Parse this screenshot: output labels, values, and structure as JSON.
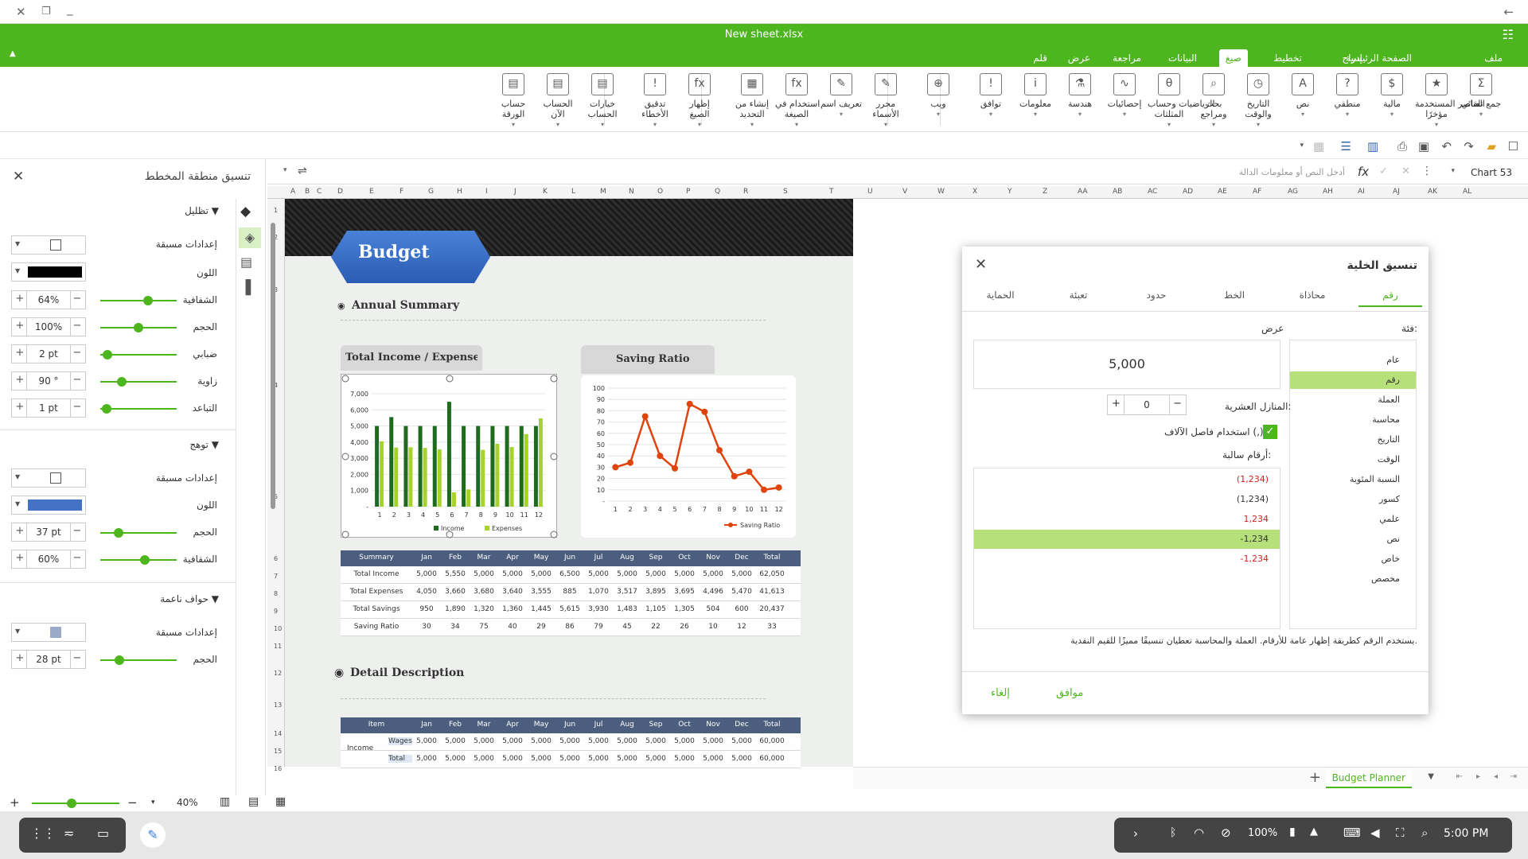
{
  "window": {
    "title": "New sheet.xlsx"
  },
  "ribbon_tabs": [
    {
      "label": "ملف",
      "x": 1876,
      "active": false
    },
    {
      "label": "الصفحة الرئيسية",
      "x": 1762,
      "active": false
    },
    {
      "label": "إدراج",
      "x": 1700,
      "active": false
    },
    {
      "label": "تخطيط",
      "x": 1624,
      "active": false
    },
    {
      "label": "صيغ",
      "x": 1548,
      "active": true
    },
    {
      "label": "البيانات",
      "x": 1492,
      "active": false
    },
    {
      "label": "مراجعة",
      "x": 1422,
      "active": false
    },
    {
      "label": "عرض",
      "x": 1358,
      "active": false
    },
    {
      "label": "قلم",
      "x": 1304,
      "active": false
    }
  ],
  "ribbon_buttons": [
    {
      "line1": "جمع تلقائي",
      "line2": "",
      "icon": "Σ"
    },
    {
      "line1": "العناصر المستخدمة",
      "line2": "مؤخرًا",
      "icon": "★"
    },
    {
      "line1": "مالية",
      "line2": "",
      "icon": "$"
    },
    {
      "line1": "منطقي",
      "line2": "",
      "icon": "?"
    },
    {
      "line1": "نص",
      "line2": "",
      "icon": "A"
    },
    {
      "line1": "التاريخ",
      "line2": "والوقت",
      "icon": "◷"
    },
    {
      "line1": "بحث",
      "line2": "ومراجع",
      "icon": "⌕"
    },
    {
      "line1": "الرياضيات وحساب",
      "line2": "المثلثات",
      "icon": "θ"
    },
    {
      "line1": "إحصائيات",
      "line2": "",
      "icon": "∿"
    },
    {
      "line1": "هندسة",
      "line2": "",
      "icon": "⚗"
    },
    {
      "line1": "معلومات",
      "line2": "",
      "icon": "i"
    },
    {
      "line1": "توافق",
      "line2": "",
      "icon": "!"
    },
    {
      "line1": "ويب",
      "line2": "",
      "icon": "⊕"
    },
    {
      "line1": "محرر",
      "line2": "الأسماء",
      "icon": "✎"
    },
    {
      "line1": "تعريف اسم",
      "line2": "",
      "icon": "✎"
    },
    {
      "line1": "استخدام في",
      "line2": "الصيغة",
      "icon": "fx"
    },
    {
      "line1": "إنشاء من",
      "line2": "التحديد",
      "icon": "▦"
    },
    {
      "line1": "إظهار",
      "line2": "الصيغ",
      "icon": "fx"
    },
    {
      "line1": "تدقيق",
      "line2": "الأخطاء",
      "icon": "!"
    },
    {
      "line1": "خيارات",
      "line2": "الحساب",
      "icon": "▤"
    },
    {
      "line1": "الحساب",
      "line2": "الآن",
      "icon": "▤"
    },
    {
      "line1": "حساب",
      "line2": "الورقة",
      "icon": "▤"
    }
  ],
  "formula_bar": {
    "name_box": "Chart 53",
    "placeholder": "أدخل النص أو معلومات الدالة",
    "fx": "fx"
  },
  "columns": [
    "A",
    "B",
    "C",
    "D",
    "E",
    "F",
    "G",
    "H",
    "I",
    "J",
    "K",
    "L",
    "M",
    "N",
    "O",
    "P",
    "Q",
    "R",
    "S",
    "T",
    "U",
    "V",
    "W",
    "X",
    "Y",
    "Z",
    "AA",
    "AB",
    "AC",
    "AD",
    "AE",
    "AF",
    "AG",
    "AH",
    "AI",
    "AJ",
    "AK",
    "AL"
  ],
  "rows": [
    "1",
    "2",
    "3",
    "4",
    "5",
    "6",
    "7",
    "8",
    "9",
    "10",
    "11",
    "12",
    "13",
    "14",
    "15",
    "16"
  ],
  "left_panel": {
    "title": "تنسيق منطقة المخطط",
    "shadow_section": "تظليل",
    "glow_section": "توهج",
    "soft_section": "حواف ناعمة",
    "presets": "إعدادات مسبقة",
    "color": "اللون",
    "transparency": "الشفافية",
    "size": "الحجم",
    "blur": "ضبابي",
    "angle": "زاوية",
    "distance": "التباعد",
    "shadow_transparency": "64%",
    "shadow_transparency_level": 0.64,
    "shadow_size": "100%",
    "shadow_size_level": 0.5,
    "shadow_blur": "2 pt",
    "shadow_blur_level": 0.04,
    "shadow_angle": "90 °",
    "shadow_angle_level": 0.25,
    "shadow_distance": "1 pt",
    "shadow_distance_level": 0.02,
    "shadow_color": "#000000",
    "glow_size": "37 pt",
    "glow_size_level": 0.2,
    "glow_transparency": "60%",
    "glow_transparency_level": 0.6,
    "glow_color": "#4472c4",
    "soft_size": "28 pt",
    "soft_size_level": 0.22
  },
  "zoom": {
    "value": "40%",
    "level": 0.4
  },
  "sheet": {
    "budget_title": "Budget",
    "annual_summary": "Annual Summary",
    "detail_description": "Detail Description",
    "chart1_title": "Total Income / Expenses",
    "chart2_title": "Saving Ratio"
  },
  "summary_table": {
    "headers": [
      "Summary",
      "Jan",
      "Feb",
      "Mar",
      "Apr",
      "May",
      "Jun",
      "Jul",
      "Aug",
      "Sep",
      "Oct",
      "Nov",
      "Dec",
      "Total"
    ],
    "rows": [
      [
        "Total Income",
        "5,000",
        "5,550",
        "5,000",
        "5,000",
        "5,000",
        "6,500",
        "5,000",
        "5,000",
        "5,000",
        "5,000",
        "5,000",
        "5,000",
        "62,050"
      ],
      [
        "Total Expenses",
        "4,050",
        "3,660",
        "3,680",
        "3,640",
        "3,555",
        "885",
        "1,070",
        "3,517",
        "3,895",
        "3,695",
        "4,496",
        "5,470",
        "41,613"
      ],
      [
        "Total Savings",
        "950",
        "1,890",
        "1,320",
        "1,360",
        "1,445",
        "5,615",
        "3,930",
        "1,483",
        "1,105",
        "1,305",
        "504",
        "600",
        "20,437"
      ],
      [
        "Saving Ratio",
        "30",
        "34",
        "75",
        "40",
        "29",
        "86",
        "79",
        "45",
        "22",
        "26",
        "10",
        "12",
        "33"
      ]
    ]
  },
  "detail_table": {
    "headers": [
      "Item",
      "Jan",
      "Feb",
      "Mar",
      "Apr",
      "May",
      "Jun",
      "Jul",
      "Aug",
      "Sep",
      "Oct",
      "Nov",
      "Dec",
      "Total"
    ],
    "group": "Income",
    "rows": [
      [
        "Wages",
        "5,000",
        "5,000",
        "5,000",
        "5,000",
        "5,000",
        "5,000",
        "5,000",
        "5,000",
        "5,000",
        "5,000",
        "5,000",
        "5,000",
        "60,000"
      ],
      [
        "Total",
        "5,000",
        "5,000",
        "5,000",
        "5,000",
        "5,000",
        "5,000",
        "5,000",
        "5,000",
        "5,000",
        "5,000",
        "5,000",
        "5,000",
        "60,000"
      ]
    ]
  },
  "chart_data": [
    {
      "type": "bar",
      "title": "Total Income / Expenses",
      "categories": [
        "1",
        "2",
        "3",
        "4",
        "5",
        "6",
        "7",
        "8",
        "9",
        "10",
        "11",
        "12"
      ],
      "series": [
        {
          "name": "Income",
          "values": [
            5000,
            5550,
            5000,
            5000,
            5000,
            6500,
            5000,
            5000,
            5000,
            5000,
            5000,
            5000
          ],
          "color": "#1e6b1e"
        },
        {
          "name": "Expenses",
          "values": [
            4050,
            3660,
            3680,
            3640,
            3555,
            885,
            1070,
            3517,
            3895,
            3695,
            4496,
            5470
          ],
          "color": "#a6d22c"
        }
      ],
      "y_ticks": [
        "-",
        "1,000",
        "2,000",
        "3,000",
        "4,000",
        "5,000",
        "6,000",
        "7,000"
      ],
      "ylim": [
        0,
        7000
      ],
      "legend": "bottom"
    },
    {
      "type": "line",
      "title": "Saving Ratio",
      "categories": [
        "1",
        "2",
        "3",
        "4",
        "5",
        "6",
        "7",
        "8",
        "9",
        "10",
        "11",
        "12"
      ],
      "series": [
        {
          "name": "Saving Ratio",
          "values": [
            30,
            34,
            75,
            40,
            29,
            86,
            79,
            45,
            22,
            26,
            10,
            12
          ],
          "color": "#e0440e"
        }
      ],
      "y_ticks": [
        "-",
        "10",
        "20",
        "30",
        "40",
        "50",
        "60",
        "70",
        "80",
        "90",
        "100"
      ],
      "ylim": [
        0,
        100
      ],
      "legend": "bottom"
    }
  ],
  "dialog": {
    "title": "تنسيق الخلية",
    "tabs": [
      "رقم",
      "محاذاة",
      "الخط",
      "حدود",
      "تعبئة",
      "الحماية"
    ],
    "category_label": "فئة:",
    "categories": [
      "عام",
      "رقم",
      "العملة",
      "محاسبة",
      "التاريخ",
      "الوقت",
      "النسبة المئوية",
      "كسور",
      "علمي",
      "نص",
      "خاص",
      "مخصص"
    ],
    "selected_category": 1,
    "display_label": "عرض",
    "display_value": "5,000",
    "decimal_label": "المنازل العشرية:",
    "decimal_value": "0",
    "thousands_label": "استخدام فاصل الآلاف (,)",
    "negative_label": "أرقام سالبة:",
    "negatives": [
      {
        "text": "(1,234)",
        "color": "#d02020"
      },
      {
        "text": "(1,234)",
        "color": "#333333"
      },
      {
        "text": "1,234",
        "color": "#d02020"
      },
      {
        "text": "-1,234",
        "color": "#333333"
      },
      {
        "text": "-1,234",
        "color": "#d02020"
      }
    ],
    "selected_negative": 3,
    "description": "يستخدم الرقم كطريقة إظهار عامة للأرقام. العملة والمحاسبة تعطيان تنسيقًا مميزًا للقيم النقدية.",
    "ok": "موافق",
    "cancel": "إلغاء"
  },
  "sheet_tab": {
    "name": "Budget Planner",
    "add": "+"
  },
  "shelf": {
    "battery": "100%",
    "time": "5:00 PM"
  }
}
